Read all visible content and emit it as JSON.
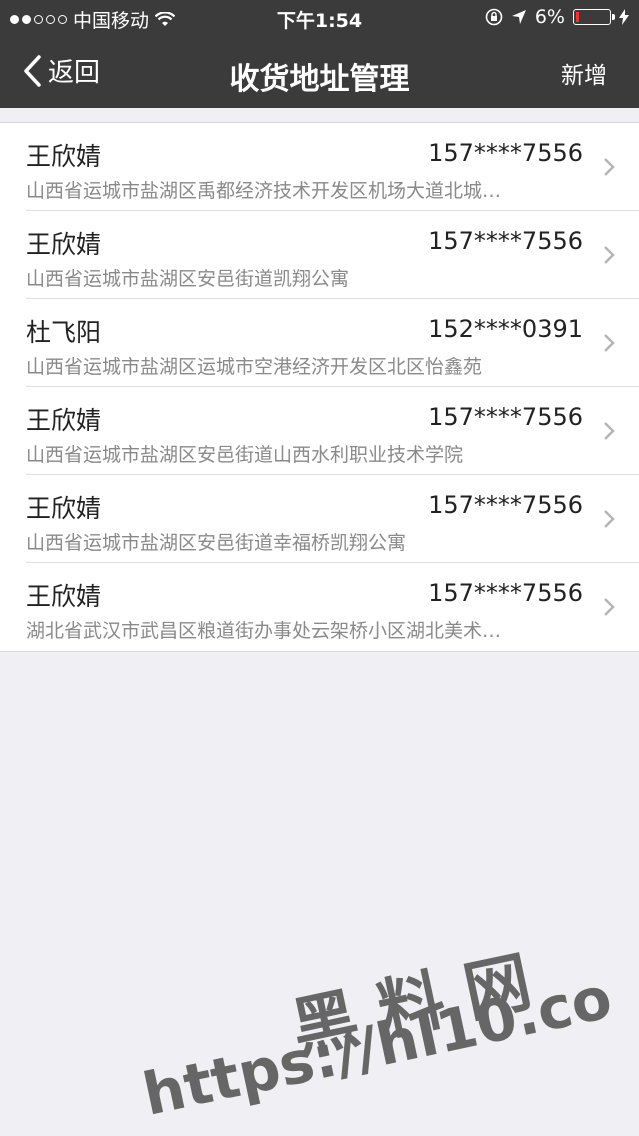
{
  "status_bar": {
    "carrier": "中国移动",
    "time": "下午1:54",
    "battery": "6%"
  },
  "nav": {
    "back_label": "返回",
    "title": "收货地址管理",
    "add_label": "新增"
  },
  "addresses": [
    {
      "name": "王欣婧",
      "phone": "157****7556",
      "address": "山西省运城市盐湖区禹都经济技术开发区机场大道北城…"
    },
    {
      "name": "王欣婧",
      "phone": "157****7556",
      "address": "山西省运城市盐湖区安邑街道凯翔公寓"
    },
    {
      "name": "杜飞阳",
      "phone": "152****0391",
      "address": "山西省运城市盐湖区运城市空港经济开发区北区怡鑫苑"
    },
    {
      "name": "王欣婧",
      "phone": "157****7556",
      "address": "山西省运城市盐湖区安邑街道山西水利职业技术学院"
    },
    {
      "name": "王欣婧",
      "phone": "157****7556",
      "address": "山西省运城市盐湖区安邑街道幸福桥凯翔公寓"
    },
    {
      "name": "王欣婧",
      "phone": "157****7556",
      "address": "湖北省武汉市武昌区粮道街办事处云架桥小区湖北美术…"
    }
  ],
  "watermark": {
    "cn": "黑料网",
    "url": "https://hl10.co"
  },
  "colors": {
    "header_bg": "#3b3b3b",
    "page_bg": "#efeff4",
    "battery_low": "#ee3333"
  }
}
